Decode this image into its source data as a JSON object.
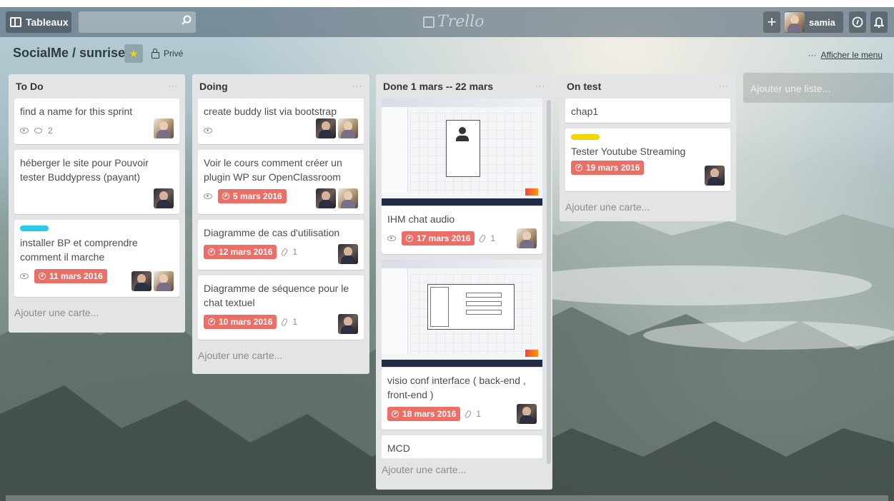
{
  "colors": {
    "accent_due": "#ec6f67",
    "label_blue": "#29cce5",
    "label_yellow": "#f2d600",
    "list_bg": "#e2e4e6"
  },
  "topbar": {
    "boards_label": "Tableaux",
    "search_placeholder": "",
    "logo_text": "Trello",
    "user_name": "samia",
    "icons": [
      "boards-icon",
      "search-icon",
      "plus-icon",
      "info-icon",
      "bell-icon"
    ]
  },
  "board": {
    "title": "SocialMe / sunrise",
    "visibility": "Privé",
    "menu_label": "Afficher le menu",
    "menu_dots": "···",
    "starred": true
  },
  "add_card_label": "Ajouter une carte...",
  "add_list_label": "Ajouter une liste...",
  "lists": [
    {
      "name": "To Do",
      "menu": "···",
      "cards": [
        {
          "title": "find a name for this sprint",
          "watch": true,
          "comments": "2"
        },
        {
          "title": "héberger le site pour Pouvoir tester Buddypress (payant)"
        },
        {
          "title": "installer BP et comprendre comment il marche",
          "label": "blue",
          "watch": true,
          "due": "11 mars 2016"
        }
      ]
    },
    {
      "name": "Doing",
      "menu": "···",
      "cards": [
        {
          "title": "create buddy list via bootstrap",
          "watch": true
        },
        {
          "title": "Voir le cours comment créer un plugin WP sur OpenClassroom",
          "watch": true,
          "due": "5 mars 2016"
        },
        {
          "title": "Diagramme de cas d'utilisation",
          "due": "12 mars 2016",
          "attachments": "1"
        },
        {
          "title": "Diagramme de séquence pour le chat textuel",
          "due": "10 mars 2016",
          "attachments": "1"
        }
      ]
    },
    {
      "name": "Done 1 mars -- 22 mars",
      "menu": "···",
      "cards": [
        {
          "title": "IHM chat audio",
          "watch": true,
          "due": "17 mars 2016",
          "attachments": "1"
        },
        {
          "title": "visio conf interface ( back-end , front-end )",
          "due": "18 mars 2016",
          "attachments": "1"
        },
        {
          "title": "MCD"
        }
      ]
    },
    {
      "name": "On test",
      "menu": "···",
      "cards": [
        {
          "title": "chap1"
        },
        {
          "title": "Tester Youtube Streaming",
          "label": "yellow",
          "due": "19 mars 2016"
        }
      ]
    }
  ]
}
